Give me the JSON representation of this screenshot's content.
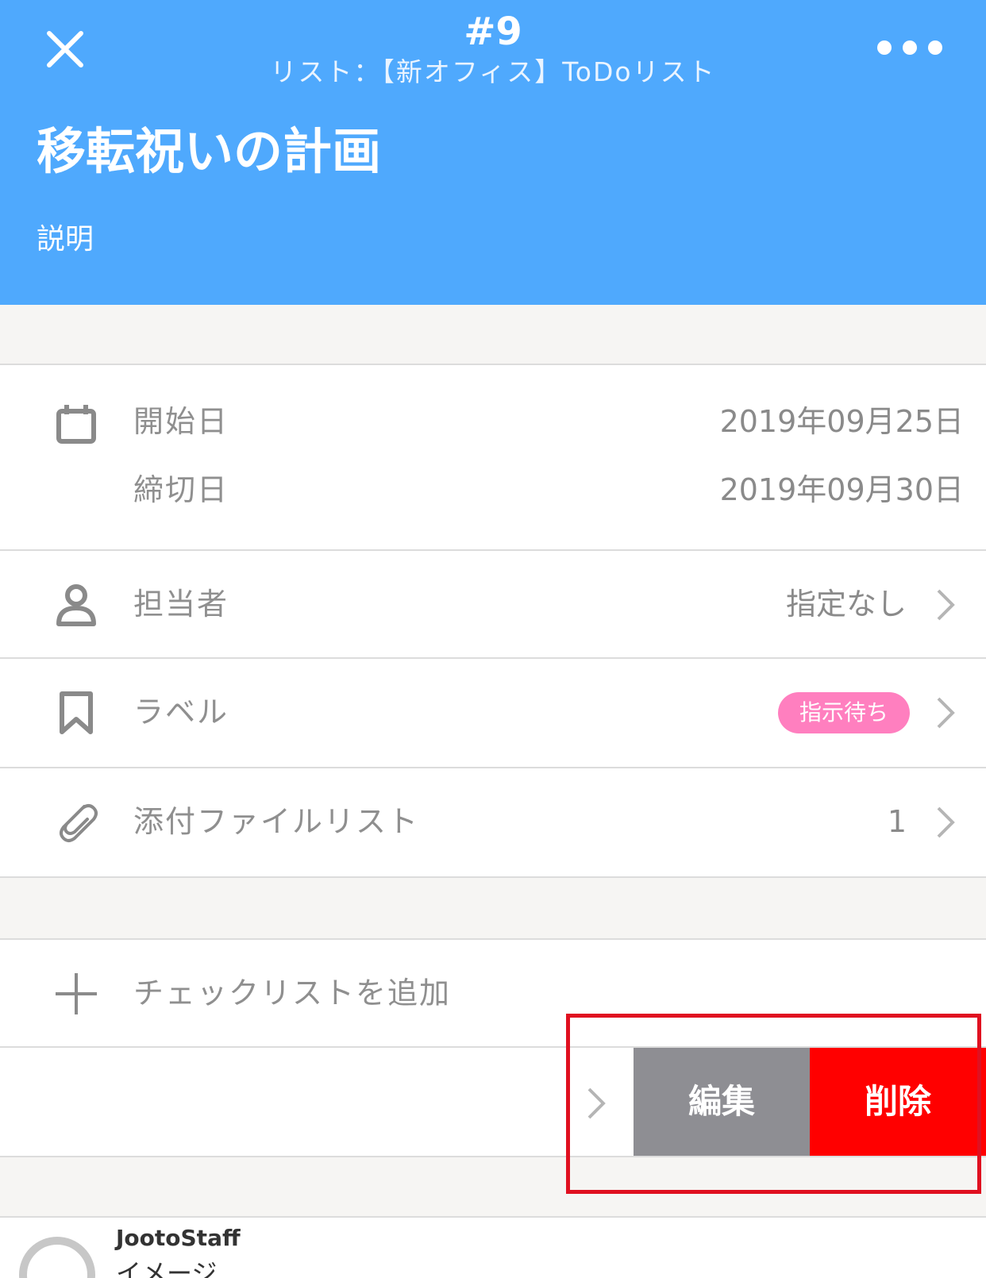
{
  "header": {
    "task_number": "#9",
    "list_line": "リスト：【新オフィス】ToDoリスト",
    "title": "移転祝いの計画",
    "description_label": "説明",
    "background_color": "#4fa9fd"
  },
  "dates": {
    "start_label": "開始日",
    "start_value": "2019年09月25日",
    "due_label": "締切日",
    "due_value": "2019年09月30日",
    "icon": "calendar-icon"
  },
  "assignee": {
    "label": "担当者",
    "value": "指定なし",
    "icon": "person-icon"
  },
  "label_row": {
    "label": "ラベル",
    "badge": "指示待ち",
    "badge_color": "#ff7fbf",
    "icon": "bookmark-icon"
  },
  "attachments": {
    "label": "添付ファイルリスト",
    "count": "1",
    "icon": "paperclip-icon"
  },
  "checklist": {
    "add_label": "チェックリストを追加",
    "icon": "plus-icon"
  },
  "swipe_actions": {
    "edit_label": "編集",
    "delete_label": "削除",
    "edit_color": "#8e8e93",
    "delete_color": "#ff0000"
  },
  "comment": {
    "user": "JootoStaff",
    "text": "イメージ"
  }
}
